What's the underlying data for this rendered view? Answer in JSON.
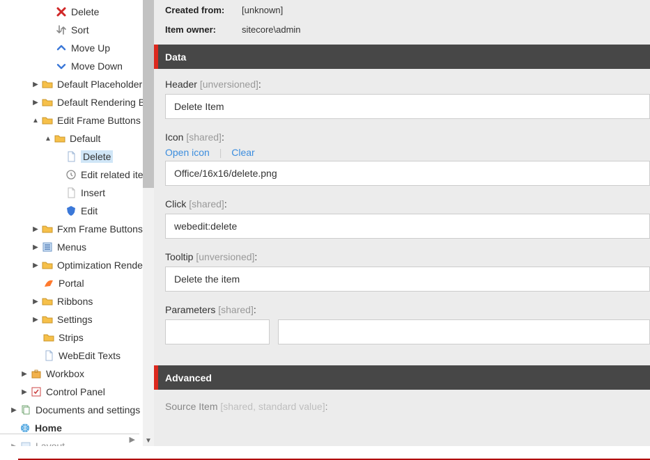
{
  "tree": {
    "action_items": {
      "delete": "Delete",
      "sort": "Sort",
      "move_up": "Move Up",
      "move_down": "Move Down"
    },
    "nodes": {
      "default_placeholder": "Default Placeholder Buttons",
      "default_rendering": "Default Rendering Buttons",
      "edit_frame": "Edit Frame Buttons",
      "default": "Default",
      "delete": "Delete",
      "edit_related": "Edit related item",
      "insert": "Insert",
      "edit": "Edit",
      "fxm_frame": "Fxm Frame Buttons",
      "menus": "Menus",
      "optimization_rendering": "Optimization Rendering",
      "portal": "Portal",
      "ribbons": "Ribbons",
      "settings": "Settings",
      "strips": "Strips",
      "webedit_texts": "WebEdit Texts",
      "workbox": "Workbox",
      "control_panel": "Control Panel",
      "documents_settings": "Documents and settings",
      "home": "Home",
      "layout": "Layout"
    }
  },
  "meta": {
    "created_from_label": "Created from:",
    "created_from_value": "[unknown]",
    "item_owner_label": "Item owner:",
    "item_owner_value": "sitecore\\admin"
  },
  "sections": {
    "data": "Data",
    "advanced": "Advanced"
  },
  "fields": {
    "header_label": "Header ",
    "header_mod": "[unversioned]",
    "header_value": "Delete Item",
    "icon_label": "Icon ",
    "icon_mod": "[shared]",
    "open_icon": "Open icon",
    "clear": "Clear",
    "icon_value": "Office/16x16/delete.png",
    "click_label": "Click ",
    "click_mod": "[shared]",
    "click_value": "webedit:delete",
    "tooltip_label": "Tooltip ",
    "tooltip_mod": "[unversioned]",
    "tooltip_value": "Delete the item",
    "parameters_label": "Parameters ",
    "parameters_mod": "[shared]",
    "source_item_label": "Source Item ",
    "source_item_mod": "[shared, standard value]"
  }
}
